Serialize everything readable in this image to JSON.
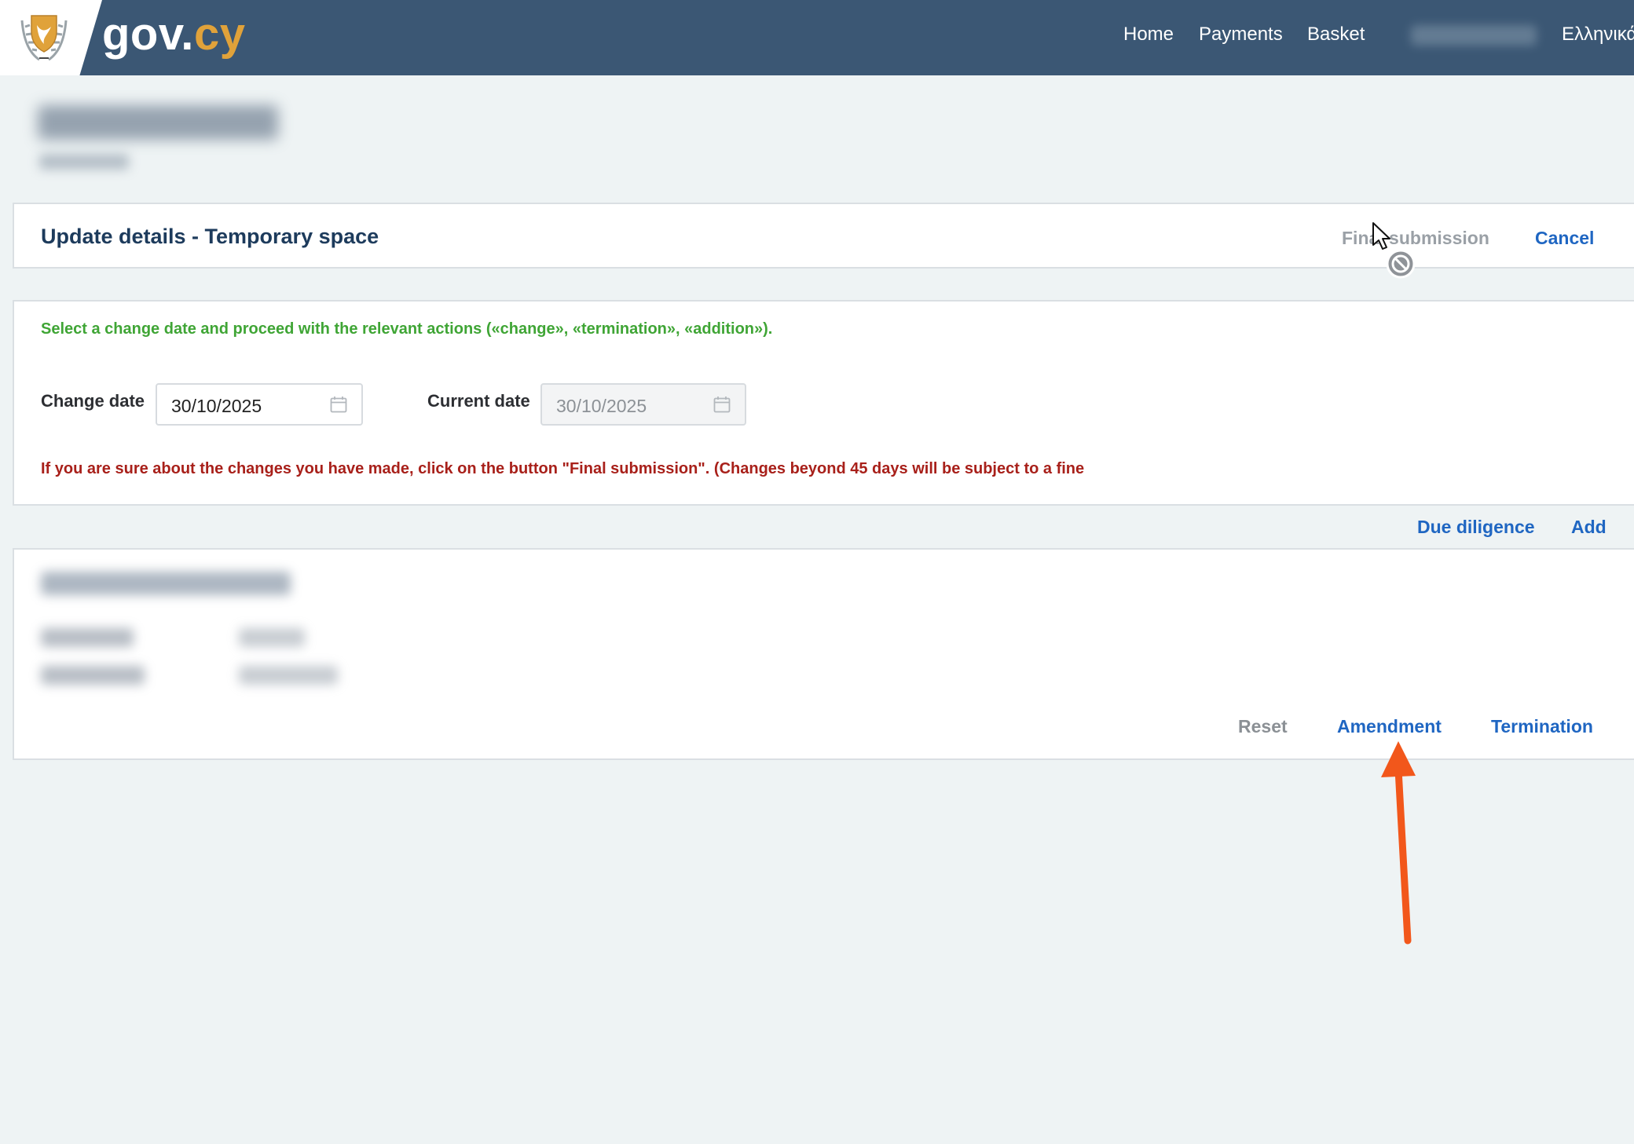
{
  "header": {
    "brand_main": "gov.",
    "brand_tld": "cy",
    "nav": {
      "home": "Home",
      "payments": "Payments",
      "basket": "Basket",
      "language": "Ελληνικά"
    }
  },
  "panel_header": {
    "title": "Update details - Temporary space",
    "final_submission": "Final submission",
    "cancel": "Cancel"
  },
  "form": {
    "instruction": "Select a change date and proceed with the relevant actions («change», «termination», «addition»).",
    "change_date_label": "Change date",
    "change_date_value": "30/10/2025",
    "current_date_label": "Current date",
    "current_date_value": "30/10/2025",
    "warning": "If you are sure about the changes you have made, click on the button \"Final submission\". (Changes beyond 45 days will be subject to a fine"
  },
  "links": {
    "due_diligence": "Due diligence",
    "add": "Add"
  },
  "person_actions": {
    "reset": "Reset",
    "amendment": "Amendment",
    "termination": "Termination"
  },
  "colors": {
    "header_bg": "#3b5774",
    "brand_accent": "#e0a23a",
    "link_blue": "#1f66c2",
    "instruction_green": "#3fa535",
    "warning_red": "#a8201a",
    "annotation_arrow": "#f2571b"
  },
  "icons": {
    "crest": "cyprus-crest-icon",
    "calendar": "calendar-icon",
    "cursor": "not-allowed-cursor-icon",
    "annotation": "up-arrow-annotation-icon"
  }
}
